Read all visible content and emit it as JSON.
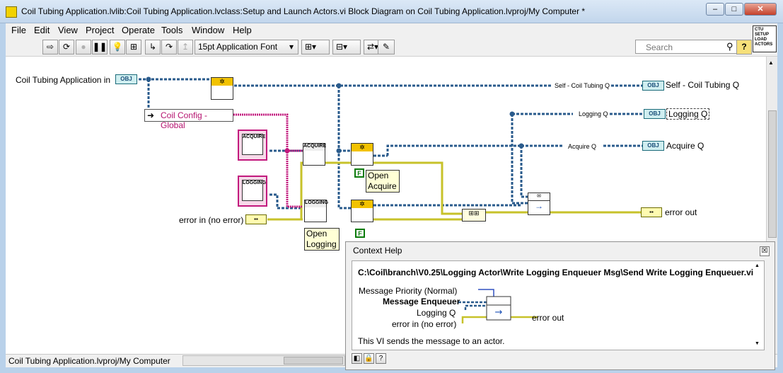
{
  "window": {
    "title": "Coil Tubing Application.lvlib:Coil Tubing Application.lvclass:Setup and Launch Actors.vi Block Diagram on Coil Tubing Application.lvproj/My Computer *",
    "controls": {
      "minimize": "–",
      "maximize": "□",
      "close": "✕"
    }
  },
  "menu": [
    "File",
    "Edit",
    "View",
    "Project",
    "Operate",
    "Tools",
    "Window",
    "Help"
  ],
  "toolbar": {
    "font_select": "15pt Application Font",
    "search_placeholder": "Search",
    "help_glyph": "?",
    "vi_icon_lines": [
      "CTU",
      "SETUP",
      "LOAD",
      "ACTORS"
    ]
  },
  "diagram": {
    "input_label": "Coil Tubing Application in",
    "obj_tag": "OBJ",
    "global_label": "Coil Config - Global",
    "acquire_class_tag": "ACQUIRE",
    "logging_class_tag": "LOGGING",
    "error_in_label": "error in (no error)",
    "open_acquire_label": "Open Acquire",
    "open_logging_label": "Open Logging",
    "false_const": "F",
    "wire_labels": {
      "self_q": "Self - Coil Tubing Q",
      "logging_q": "Logging Q",
      "acquire_q": "Acquire Q"
    },
    "outputs": {
      "self_q": "Self - Coil Tubing Q",
      "logging_q": "Logging Q",
      "acquire_q": "Acquire Q",
      "error_out": "error out"
    }
  },
  "context_help": {
    "title": "Context Help",
    "path": "C:\\Coil\\branch\\V0.25\\Logging Actor\\Write Logging Enqueuer Msg\\Send Write Logging Enqueuer.vi",
    "terminals": {
      "priority": "Message Priority (Normal)",
      "enqueuer": "Message Enqueuer",
      "logging_q": "Logging Q",
      "error_in": "error in (no error)",
      "error_out": "error out"
    },
    "description": "This VI sends the message to an actor.",
    "close_glyph": "☒",
    "buttons": [
      "◧",
      "🔒",
      "?"
    ]
  },
  "status_bar": {
    "project": "Coil Tubing Application.lvproj/My Computer"
  },
  "colors": {
    "class_wire": "#2a5b8c",
    "error_wire": "#c7c22a",
    "cluster_wire": "#c2197d",
    "bool_const": "#0a7a0a",
    "title_bar": "#c2d6ec"
  }
}
